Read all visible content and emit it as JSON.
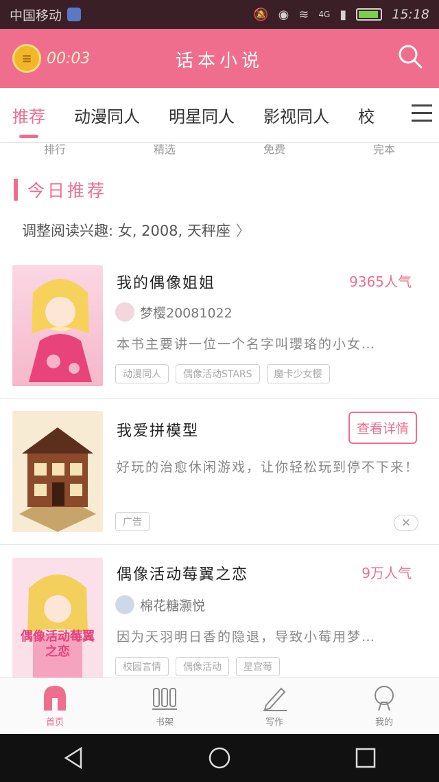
{
  "status_bar": {
    "carrier": "中国移动",
    "network": "4G",
    "time": "15:18"
  },
  "header": {
    "timer": "00:03",
    "title": "话本小说"
  },
  "tabs": [
    {
      "label": "推荐",
      "active": true
    },
    {
      "label": "动漫同人",
      "active": false
    },
    {
      "label": "明星同人",
      "active": false
    },
    {
      "label": "影视同人",
      "active": false
    },
    {
      "label": "校",
      "active": false
    }
  ],
  "quick_links": [
    "排行",
    "精选",
    "免费",
    "完本"
  ],
  "section": {
    "title": "今日推荐",
    "interest": "调整阅读兴趣: 女, 2008, 天秤座"
  },
  "books": [
    {
      "title": "我的偶像姐姐",
      "popularity": "9365人气",
      "author": "梦樱20081022",
      "description": "本书主要讲一位一个名字叫瓔珞的小女…",
      "tags": [
        "动漫同人",
        "偶像活动STARS",
        "魔卡少女樱"
      ]
    },
    {
      "title": "我爱拼模型",
      "button": "查看详情",
      "description": "好玩的治愈休闲游戏，让你轻松玩到停不下来！",
      "tags": [
        "广告"
      ],
      "close": "✕"
    },
    {
      "title": "偶像活动莓翼之恋",
      "popularity": "9万人气",
      "author": "棉花糖灏悦",
      "description": "因为天羽明日香的隐退，导致小莓用梦…",
      "tags": [
        "校园言情",
        "偶像活动",
        "星宫莓"
      ],
      "cover_text": "偶像活动莓翼之恋"
    }
  ],
  "bottom_nav": [
    {
      "label": "首页",
      "active": true
    },
    {
      "label": "书架",
      "active": false
    },
    {
      "label": "写作",
      "active": false
    },
    {
      "label": "我的",
      "active": false
    }
  ],
  "colors": {
    "accent": "#ef6e8e",
    "status_bar": "#3a1f26"
  }
}
